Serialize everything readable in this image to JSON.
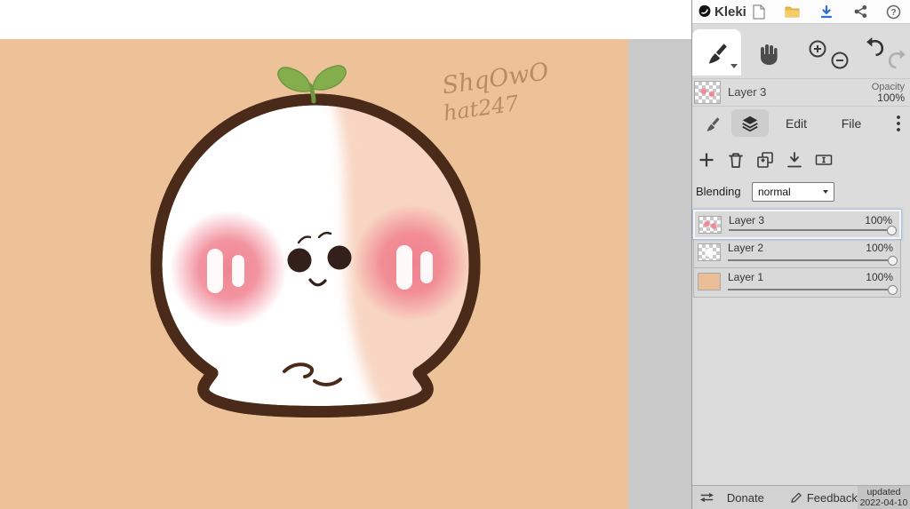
{
  "app": {
    "name": "Kleki"
  },
  "header": {
    "icons": {
      "help_glyph": "?"
    }
  },
  "layer_preview": {
    "name": "Layer 3",
    "opacity_label": "Opacity",
    "opacity_value": "100%"
  },
  "tabs": {
    "edit": "Edit",
    "file": "File"
  },
  "layers_panel": {
    "blending_label": "Blending",
    "blending_value": "normal",
    "layers": [
      {
        "name": "Layer 3",
        "opacity": "100%"
      },
      {
        "name": "Layer 2",
        "opacity": "100%"
      },
      {
        "name": "Layer 1",
        "opacity": "100%"
      }
    ]
  },
  "footer": {
    "donate": "Donate",
    "feedback": "Feedback",
    "updated_label": "updated",
    "updated_date": "2022-04-10"
  },
  "canvas": {
    "signature_line1": "ShqOwO",
    "signature_line2": "hat247",
    "background_color": "#edc299",
    "outline_color": "#4a2b1a",
    "shade_color": "#f8d5c2",
    "cheek_color": "#f07d8c",
    "sprout_color": "#84ae4c"
  },
  "colors": {
    "accent_download": "#2d6fd2",
    "folder_yellow": "#edb84a",
    "sidebar_bg": "#dcdcdc"
  }
}
